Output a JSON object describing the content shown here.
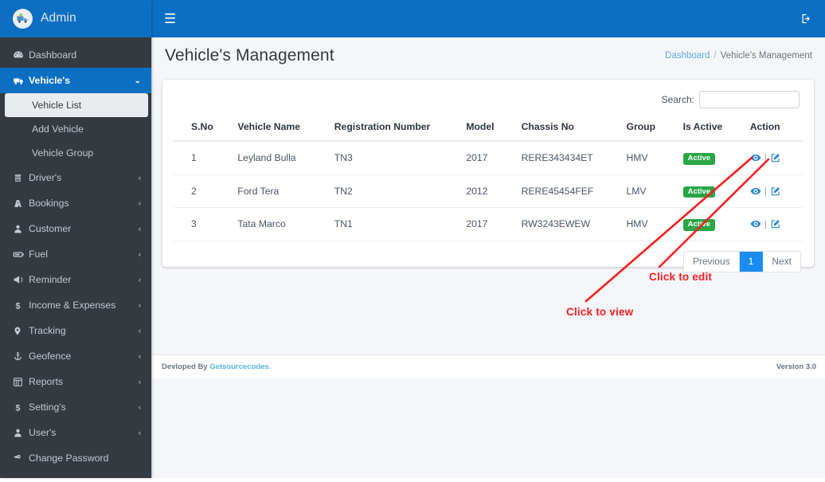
{
  "brand": {
    "title": "Admin",
    "logo_icon": "truck-logo-icon"
  },
  "navbar": {
    "hamburger_icon": "hamburger-menu-icon",
    "logout_icon": "logout-icon"
  },
  "sidebar": {
    "items": [
      {
        "label": "Dashboard",
        "icon": "dashboard-icon",
        "caret": "",
        "active": false
      },
      {
        "label": "Vehicle's",
        "icon": "truck-icon",
        "caret": "⌄",
        "active": true
      },
      {
        "label": "Driver's",
        "icon": "driver-icon",
        "caret": "‹",
        "active": false
      },
      {
        "label": "Bookings",
        "icon": "bookings-icon",
        "caret": "‹",
        "active": false
      },
      {
        "label": "Customer",
        "icon": "customer-icon",
        "caret": "‹",
        "active": false
      },
      {
        "label": "Fuel",
        "icon": "fuel-icon",
        "caret": "‹",
        "active": false
      },
      {
        "label": "Reminder",
        "icon": "megaphone-icon",
        "caret": "‹",
        "active": false
      },
      {
        "label": "Income & Expenses",
        "icon": "dollar-icon",
        "caret": "‹",
        "active": false
      },
      {
        "label": "Tracking",
        "icon": "map-pin-icon",
        "caret": "‹",
        "active": false
      },
      {
        "label": "Geofence",
        "icon": "anchor-icon",
        "caret": "‹",
        "active": false
      },
      {
        "label": "Reports",
        "icon": "reports-icon",
        "caret": "‹",
        "active": false
      },
      {
        "label": "Setting's",
        "icon": "dollar-icon",
        "caret": "‹",
        "active": false
      },
      {
        "label": "User's",
        "icon": "user-icon",
        "caret": "‹",
        "active": false
      },
      {
        "label": "Change Password",
        "icon": "key-icon",
        "caret": "",
        "active": false
      }
    ],
    "submenu": [
      {
        "label": "Vehicle List",
        "selected": true
      },
      {
        "label": "Add Vehicle",
        "selected": false
      },
      {
        "label": "Vehicle Group",
        "selected": false
      }
    ]
  },
  "page": {
    "title": "Vehicle's Management",
    "breadcrumb": {
      "home": "Dashboard",
      "separator": "/",
      "current": "Vehicle's Management"
    }
  },
  "search": {
    "label": "Search:",
    "value": "",
    "placeholder": ""
  },
  "table": {
    "columns": [
      "S.No",
      "Vehicle Name",
      "Registration Number",
      "Model",
      "Chassis No",
      "Group",
      "Is Active",
      "Action"
    ],
    "rows": [
      {
        "sno": "1",
        "vehicle_name": "Leyland Bulla",
        "registration_number": "TN3",
        "model": "2017",
        "chassis_no": "RERE343434ET",
        "group": "HMV",
        "is_active": "Active",
        "view_icon": "eye-icon",
        "separator": "|",
        "edit_icon": "edit-pencil-icon"
      },
      {
        "sno": "2",
        "vehicle_name": "Ford Tera",
        "registration_number": "TN2",
        "model": "2012",
        "chassis_no": "RERE45454FEF",
        "group": "LMV",
        "is_active": "Active",
        "view_icon": "eye-icon",
        "separator": "|",
        "edit_icon": "edit-pencil-icon"
      },
      {
        "sno": "3",
        "vehicle_name": "Tata Marco",
        "registration_number": "TN1",
        "model": "2017",
        "chassis_no": "RW3243EWEW",
        "group": "HMV",
        "is_active": "Active",
        "view_icon": "eye-icon",
        "separator": "|",
        "edit_icon": "edit-pencil-icon"
      }
    ]
  },
  "pagination": {
    "previous": "Previous",
    "pages": [
      "1"
    ],
    "next": "Next",
    "current_page": "1"
  },
  "footer": {
    "developed_by": "Devloped By",
    "developer_link": "Getsourcecodes.",
    "version": "Version 3.0"
  },
  "annotations": [
    {
      "text": "Click to view"
    },
    {
      "text": "Click to edit"
    }
  ],
  "colors": {
    "brand_blue": "#0d6fc2",
    "sidebar_dark": "#343a40",
    "content_bg": "#f4f6f9",
    "badge_green": "#28a745",
    "action_blue": "#2f86d6",
    "pagination_active": "#1a8cf0",
    "annotation_red": "#fc1d1d",
    "link_blue": "#62a8e5"
  }
}
